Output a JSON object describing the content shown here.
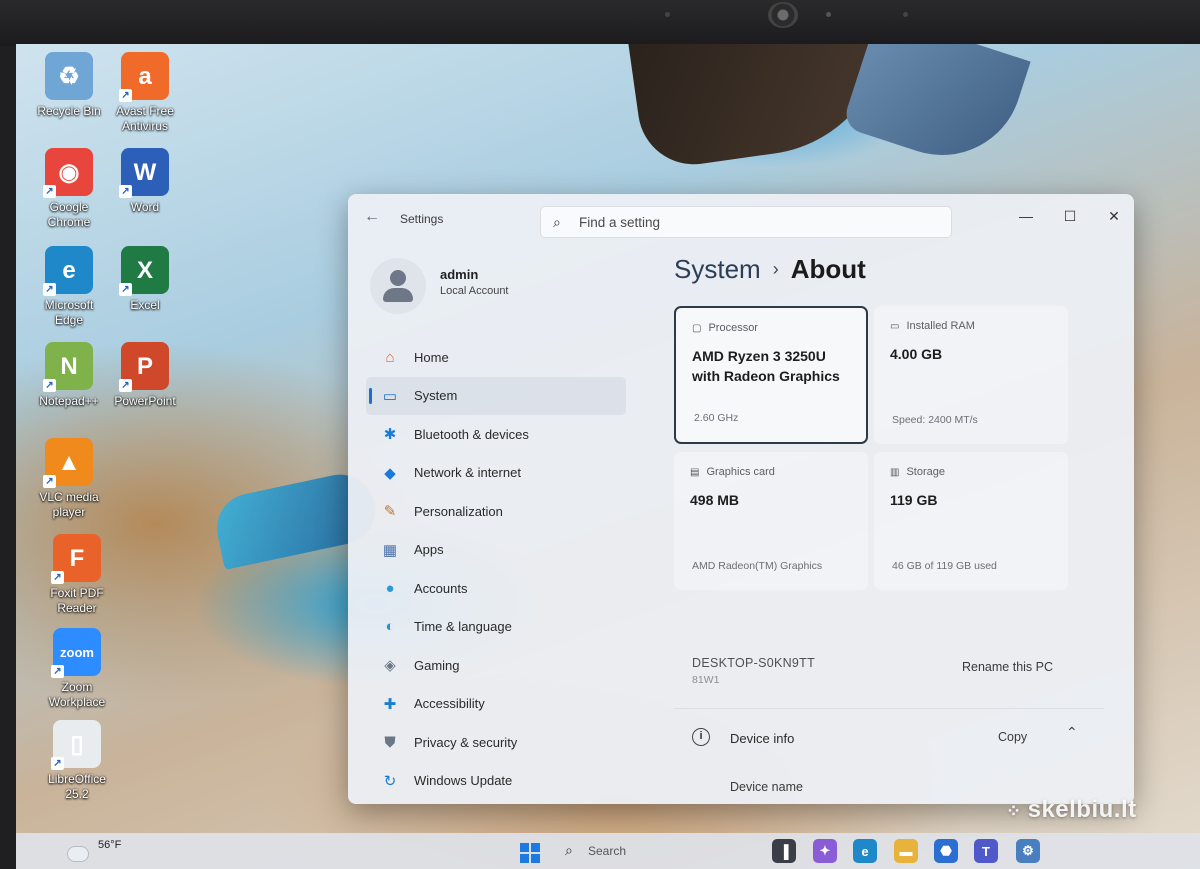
{
  "desktop_icons": [
    {
      "label": "Recycle Bin",
      "icon": "recycle-bin-icon",
      "color": "#6fa6d6",
      "glyph": "♻"
    },
    {
      "label": "Avast Free Antivirus",
      "icon": "avast-icon",
      "color": "#f06a2a",
      "glyph": "a"
    },
    {
      "label": "Google Chrome",
      "icon": "chrome-icon",
      "color": "#e8453c",
      "glyph": "◉"
    },
    {
      "label": "Word",
      "icon": "word-icon",
      "color": "#2b5fb8",
      "glyph": "W"
    },
    {
      "label": "Microsoft Edge",
      "icon": "edge-icon",
      "color": "#1e88c8",
      "glyph": "e"
    },
    {
      "label": "Excel",
      "icon": "excel-icon",
      "color": "#1f7a44",
      "glyph": "X"
    },
    {
      "label": "Notepad++",
      "icon": "notepadpp-icon",
      "color": "#7fb24b",
      "glyph": "N"
    },
    {
      "label": "PowerPoint",
      "icon": "powerpoint-icon",
      "color": "#d0482a",
      "glyph": "P"
    },
    {
      "label": "VLC media player",
      "icon": "vlc-icon",
      "color": "#f08a1c",
      "glyph": "▲"
    },
    {
      "label": "Foxit PDF Reader",
      "icon": "foxit-icon",
      "color": "#e8622a",
      "glyph": "F"
    },
    {
      "label": "Zoom Workplace",
      "icon": "zoom-icon",
      "color": "#2d8cff",
      "glyph": "zoom"
    },
    {
      "label": "LibreOffice 25.2",
      "icon": "libreoffice-icon",
      "color": "#e9ecef",
      "glyph": "▯"
    }
  ],
  "window": {
    "title": "Settings",
    "search_placeholder": "Find a setting",
    "minimize": "—",
    "maximize": "☐",
    "close": "✕"
  },
  "user": {
    "name": "admin",
    "account_type": "Local Account"
  },
  "nav": [
    {
      "label": "Home",
      "icon": "home-icon",
      "glyph": "⌂",
      "color": "#d66a3a",
      "active": false
    },
    {
      "label": "System",
      "icon": "system-icon",
      "glyph": "▭",
      "color": "#1a6fd1",
      "active": true
    },
    {
      "label": "Bluetooth & devices",
      "icon": "bluetooth-icon",
      "glyph": "✱",
      "color": "#1a7ad8",
      "active": false
    },
    {
      "label": "Network & internet",
      "icon": "wifi-icon",
      "glyph": "◆",
      "color": "#1a7ad8",
      "active": false
    },
    {
      "label": "Personalization",
      "icon": "brush-icon",
      "glyph": "✎",
      "color": "#c0752f",
      "active": false
    },
    {
      "label": "Apps",
      "icon": "apps-icon",
      "glyph": "▦",
      "color": "#4a6fa8",
      "active": false
    },
    {
      "label": "Accounts",
      "icon": "accounts-icon",
      "glyph": "●",
      "color": "#2c9ad8",
      "active": false
    },
    {
      "label": "Time & language",
      "icon": "globe-clock-icon",
      "glyph": "◐",
      "color": "#2a8ed0",
      "active": false
    },
    {
      "label": "Gaming",
      "icon": "gamepad-icon",
      "glyph": "◈",
      "color": "#6b7785",
      "active": false
    },
    {
      "label": "Accessibility",
      "icon": "accessibility-icon",
      "glyph": "✚",
      "color": "#1b7fd1",
      "active": false
    },
    {
      "label": "Privacy & security",
      "icon": "shield-icon",
      "glyph": "⛊",
      "color": "#6b7785",
      "active": false
    },
    {
      "label": "Windows Update",
      "icon": "update-icon",
      "glyph": "↻",
      "color": "#1a7ad8",
      "active": false
    }
  ],
  "breadcrumb": {
    "parent": "System",
    "separator": "›",
    "current": "About"
  },
  "specs": {
    "processor": {
      "label": "Processor",
      "value": "AMD Ryzen 3 3250U with Radeon Graphics",
      "sub": "2.60 GHz"
    },
    "ram": {
      "label": "Installed RAM",
      "value": "4.00 GB",
      "sub": "Speed: 2400 MT/s"
    },
    "graphics": {
      "label": "Graphics card",
      "value": "498 MB",
      "sub": "AMD Radeon(TM) Graphics"
    },
    "storage": {
      "label": "Storage",
      "value": "119 GB",
      "sub": "46 GB of 119 GB used"
    }
  },
  "pc": {
    "name": "DESKTOP-S0KN9TT",
    "model": "81W1",
    "rename_label": "Rename this PC"
  },
  "device_info": {
    "title": "Device info",
    "copy_label": "Copy",
    "first_row": "Device name"
  },
  "taskbar": {
    "temperature": "56°F",
    "search_label": "Search",
    "apps": [
      {
        "icon": "task-view-icon",
        "color": "#3a3f47",
        "glyph": "▐"
      },
      {
        "icon": "copilot-icon",
        "color": "#8a5cd6",
        "glyph": "✦"
      },
      {
        "icon": "edge-taskbar-icon",
        "color": "#1e88c8",
        "glyph": "e"
      },
      {
        "icon": "file-explorer-icon",
        "color": "#e8b33a",
        "glyph": "▬"
      },
      {
        "icon": "store-icon",
        "color": "#2a6fd1",
        "glyph": "⬣"
      },
      {
        "icon": "teams-icon",
        "color": "#5059c9",
        "glyph": "T"
      },
      {
        "icon": "settings-taskbar-icon",
        "color": "#4a7fbf",
        "glyph": "⚙"
      }
    ]
  },
  "watermark": "skelbiu.lt"
}
